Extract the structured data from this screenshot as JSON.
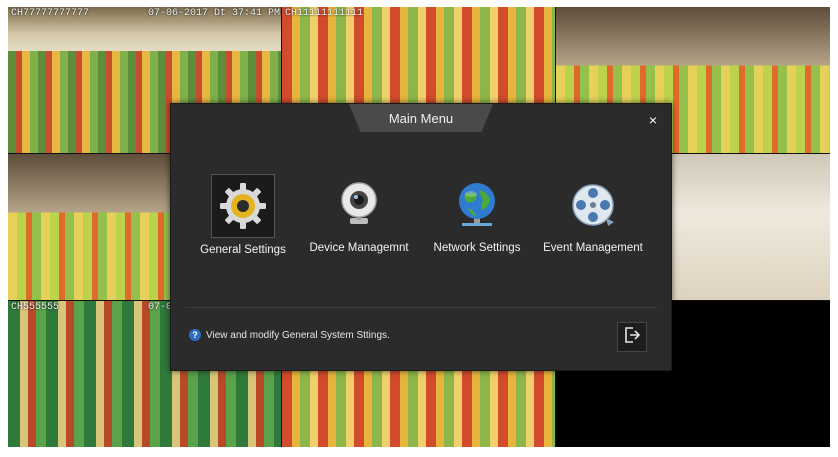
{
  "channels": [
    {
      "label": "CH77777777777",
      "timestamp": "07-06-2017 Dt 37:41 PM"
    },
    {
      "label": "CH11111111111"
    },
    {
      "label": ""
    },
    {
      "label": "CH555555",
      "timestamp": "07-0"
    }
  ],
  "dialog": {
    "title": "Main Menu",
    "close_glyph": "×",
    "items": [
      {
        "label": "General Settings",
        "icon": "gear-icon",
        "active": true
      },
      {
        "label": "Device Managemnt",
        "icon": "camera-icon",
        "active": false
      },
      {
        "label": "Network Settings",
        "icon": "globe-network-icon",
        "active": false
      },
      {
        "label": "Event Management",
        "icon": "film-reel-icon",
        "active": false
      }
    ],
    "hint_text": "View and modify General System Sttings.",
    "hint_icon": "?"
  },
  "colors": {
    "dialog_bg": "#2b2b2b",
    "header_tab": "#4a4a4a",
    "hint_icon": "#2e6ec2"
  }
}
